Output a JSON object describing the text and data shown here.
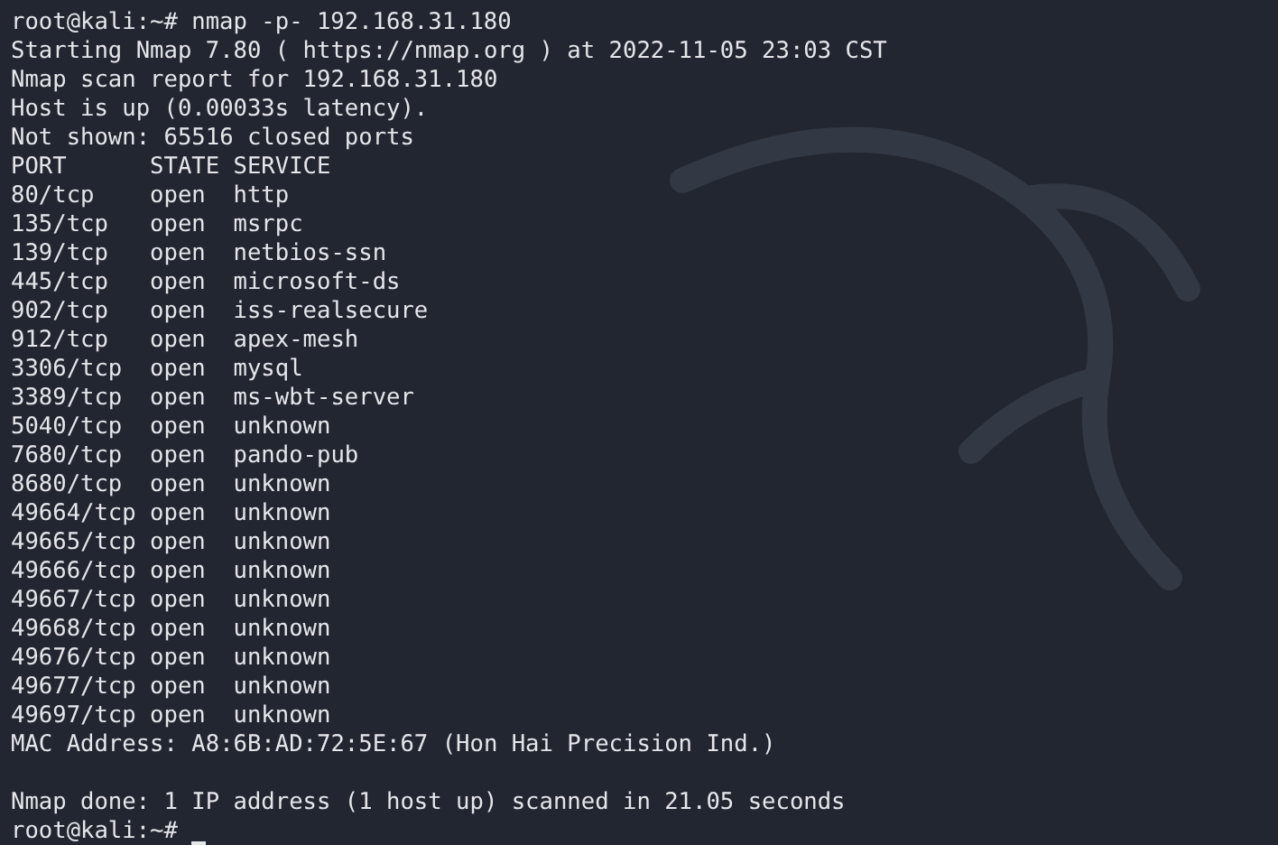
{
  "terminal": {
    "lines": [
      {
        "kind": "prompt",
        "prompt": "root@kali:~#",
        "command": "nmap -p- 192.168.31.180"
      },
      {
        "kind": "text",
        "text": "Starting Nmap 7.80 ( https://nmap.org ) at 2022-11-05 23:03 CST"
      },
      {
        "kind": "text",
        "text": "Nmap scan report for 192.168.31.180"
      },
      {
        "kind": "text",
        "text": "Host is up (0.00033s latency)."
      },
      {
        "kind": "text",
        "text": "Not shown: 65516 closed ports"
      },
      {
        "kind": "text",
        "text": "PORT      STATE SERVICE"
      },
      {
        "kind": "text",
        "text": "80/tcp    open  http"
      },
      {
        "kind": "text",
        "text": "135/tcp   open  msrpc"
      },
      {
        "kind": "text",
        "text": "139/tcp   open  netbios-ssn"
      },
      {
        "kind": "text",
        "text": "445/tcp   open  microsoft-ds"
      },
      {
        "kind": "text",
        "text": "902/tcp   open  iss-realsecure"
      },
      {
        "kind": "text",
        "text": "912/tcp   open  apex-mesh"
      },
      {
        "kind": "text",
        "text": "3306/tcp  open  mysql"
      },
      {
        "kind": "text",
        "text": "3389/tcp  open  ms-wbt-server"
      },
      {
        "kind": "text",
        "text": "5040/tcp  open  unknown"
      },
      {
        "kind": "text",
        "text": "7680/tcp  open  pando-pub"
      },
      {
        "kind": "text",
        "text": "8680/tcp  open  unknown"
      },
      {
        "kind": "text",
        "text": "49664/tcp open  unknown"
      },
      {
        "kind": "text",
        "text": "49665/tcp open  unknown"
      },
      {
        "kind": "text",
        "text": "49666/tcp open  unknown"
      },
      {
        "kind": "text",
        "text": "49667/tcp open  unknown"
      },
      {
        "kind": "text",
        "text": "49668/tcp open  unknown"
      },
      {
        "kind": "text",
        "text": "49676/tcp open  unknown"
      },
      {
        "kind": "text",
        "text": "49677/tcp open  unknown"
      },
      {
        "kind": "text",
        "text": "49697/tcp open  unknown"
      },
      {
        "kind": "text",
        "text": "MAC Address: A8:6B:AD:72:5E:67 (Hon Hai Precision Ind.)"
      },
      {
        "kind": "blank"
      },
      {
        "kind": "text",
        "text": "Nmap done: 1 IP address (1 host up) scanned in 21.05 seconds"
      },
      {
        "kind": "prompt",
        "prompt": "root@kali:~#",
        "cursor": true
      }
    ]
  }
}
